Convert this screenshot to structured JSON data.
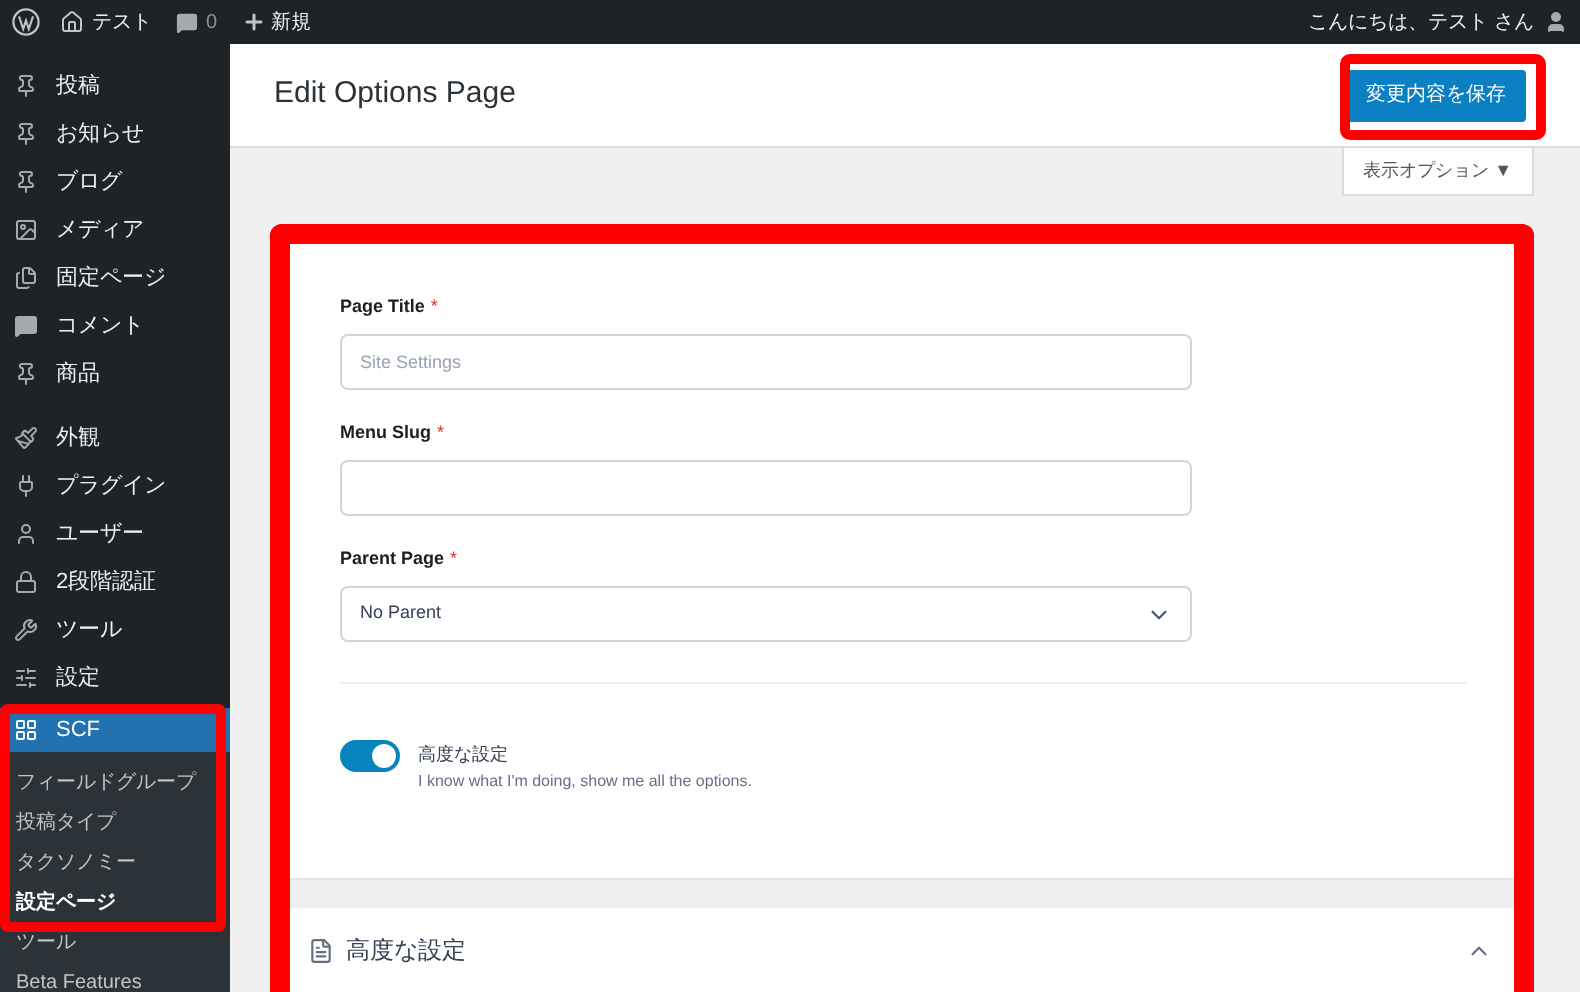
{
  "admin_bar": {
    "site": "テスト",
    "comments": "0",
    "new": "新規",
    "greeting": "こんにちは、テスト さん"
  },
  "sidebar": {
    "groups": [
      [
        {
          "label": "投稿"
        },
        {
          "label": "お知らせ"
        },
        {
          "label": "ブログ"
        },
        {
          "label": "メディア"
        },
        {
          "label": "固定ページ"
        },
        {
          "label": "コメント"
        },
        {
          "label": "商品"
        }
      ],
      [
        {
          "label": "外観"
        },
        {
          "label": "プラグイン"
        },
        {
          "label": "ユーザー"
        },
        {
          "label": "2段階認証"
        },
        {
          "label": "ツール"
        },
        {
          "label": "設定"
        }
      ]
    ],
    "active": {
      "label": "SCF",
      "submenu": [
        {
          "label": "フィールドグループ",
          "selected": false
        },
        {
          "label": "投稿タイプ",
          "selected": false
        },
        {
          "label": "タクソノミー",
          "selected": false
        },
        {
          "label": "設定ページ",
          "selected": true
        },
        {
          "label": "ツール",
          "selected": false
        },
        {
          "label": "Beta Features",
          "selected": false
        }
      ]
    }
  },
  "header": {
    "title": "Edit Options Page",
    "save_button": "変更内容を保存",
    "screen_options": "表示オプション ▼"
  },
  "form": {
    "fields": [
      {
        "kind": "text",
        "label": "Page Title",
        "required_mark": "*",
        "placeholder": "Site Settings"
      },
      {
        "kind": "text",
        "label": "Menu Slug",
        "required_mark": "*"
      },
      {
        "kind": "select",
        "label": "Parent Page",
        "required_mark": "*",
        "value": "No Parent"
      }
    ],
    "toggle": {
      "label": "高度な設定",
      "description": "I know what I'm doing, show me all the options.",
      "on": true
    }
  },
  "accordion": {
    "title": "高度な設定",
    "expanded": true
  }
}
